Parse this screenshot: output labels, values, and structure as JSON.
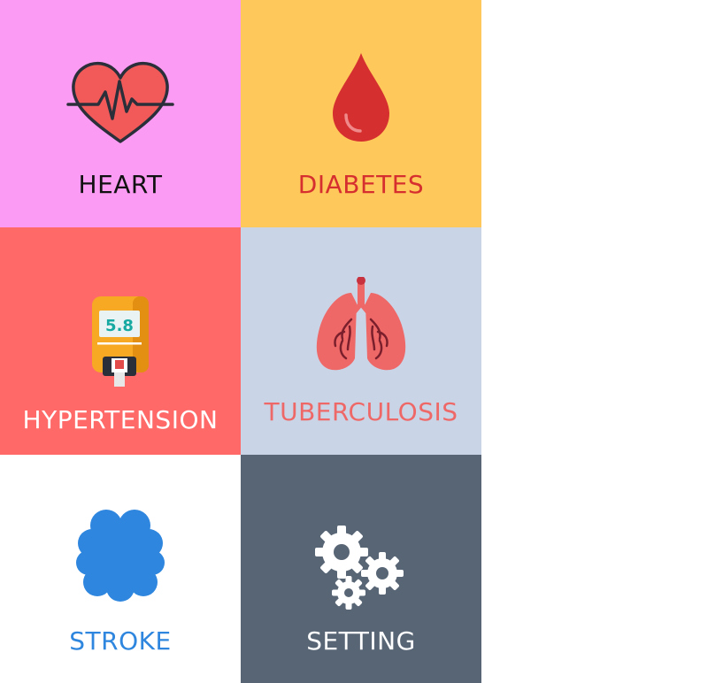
{
  "tiles": [
    {
      "id": "heart",
      "label": "HEART",
      "bg": "#fc9bf3",
      "text_color": "#111111",
      "icon": "heart-pulse-icon"
    },
    {
      "id": "diabetes",
      "label": "DIABETES",
      "bg": "#fec85a",
      "text_color": "#d62f2f",
      "icon": "blood-drop-icon"
    },
    {
      "id": "hypertension",
      "label": "HYPERTENSION",
      "bg": "#ff6a69",
      "text_color": "#ffffff",
      "icon": "glucometer-icon",
      "icon_reading": "5.8"
    },
    {
      "id": "tuberculosis",
      "label": "TUBERCULOSIS",
      "bg": "#c9d5e6",
      "text_color": "#ef6868",
      "icon": "lungs-icon"
    },
    {
      "id": "stroke",
      "label": "STROKE",
      "bg": "#ffffff",
      "text_color": "#2e86de",
      "icon": "brain-icon"
    },
    {
      "id": "setting",
      "label": "SETTING",
      "bg": "#586575",
      "text_color": "#ffffff",
      "icon": "gears-icon"
    }
  ]
}
